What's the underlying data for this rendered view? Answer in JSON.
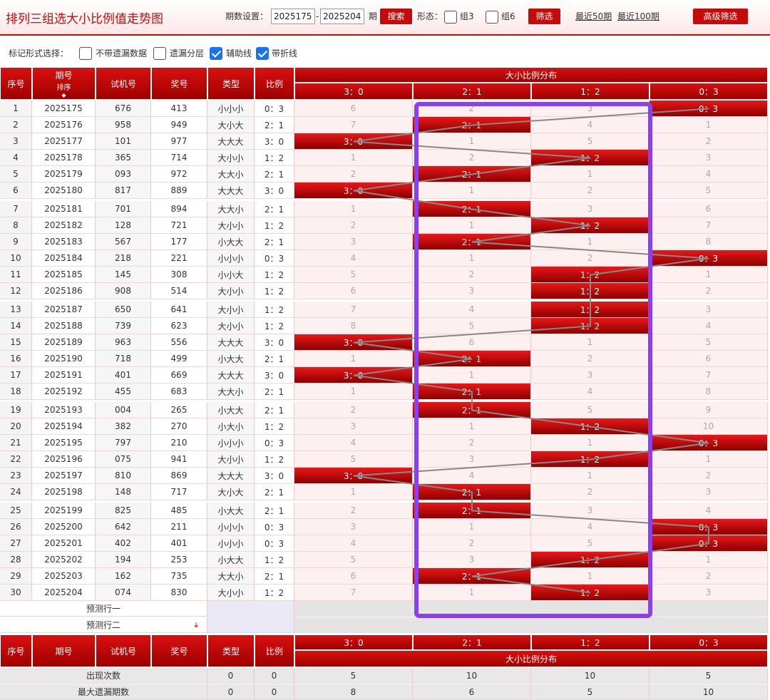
{
  "header": {
    "title": "排列三组选大小比例值走势图",
    "period_label": "期数设置：",
    "from": "2025175",
    "dash": "-",
    "to": "2025204",
    "period_unit": "期",
    "search": "搜索",
    "form_label": "形态：",
    "g3": "组3",
    "g6": "组6",
    "filter": "筛选",
    "recent50": "最近50期",
    "recent100": "最近100期",
    "advanced": "高级筛选"
  },
  "options": {
    "label": "标记形式选择：",
    "items": [
      {
        "label": "不带遗漏数据",
        "checked": false
      },
      {
        "label": "遗漏分层",
        "checked": false
      },
      {
        "label": "辅助线",
        "checked": true
      },
      {
        "label": "带折线",
        "checked": true
      }
    ]
  },
  "table": {
    "h_no": "序号",
    "h_period": "期号",
    "h_sort": "排序",
    "h_trial": "试机号",
    "h_award": "奖号",
    "h_type": "类型",
    "h_ratio": "比例",
    "h_dist": "大小比例分布",
    "cats": [
      "3：0",
      "2：1",
      "1：2",
      "0：3"
    ],
    "rows": [
      [
        "1",
        "2025175",
        "676",
        "413",
        "小小小",
        "0：3",
        [
          "6",
          "2",
          "3",
          "0：3"
        ]
      ],
      [
        "2",
        "2025176",
        "958",
        "949",
        "大小大",
        "2：1",
        [
          "7",
          "2：1",
          "4",
          "1"
        ]
      ],
      [
        "3",
        "2025177",
        "101",
        "977",
        "大大大",
        "3：0",
        [
          "3：0",
          "1",
          "5",
          "2"
        ]
      ],
      [
        "4",
        "2025178",
        "365",
        "714",
        "大小小",
        "1：2",
        [
          "1",
          "2",
          "1：2",
          "3"
        ]
      ],
      [
        "5",
        "2025179",
        "093",
        "972",
        "大大小",
        "2：1",
        [
          "2",
          "2：1",
          "1",
          "4"
        ]
      ],
      [
        "6",
        "2025180",
        "817",
        "889",
        "大大大",
        "3：0",
        [
          "3：0",
          "1",
          "2",
          "5"
        ]
      ],
      [
        "7",
        "2025181",
        "701",
        "894",
        "大大小",
        "2：1",
        [
          "1",
          "2：1",
          "3",
          "6"
        ]
      ],
      [
        "8",
        "2025182",
        "128",
        "721",
        "大小小",
        "1：2",
        [
          "2",
          "1",
          "1：2",
          "7"
        ]
      ],
      [
        "9",
        "2025183",
        "567",
        "177",
        "小大大",
        "2：1",
        [
          "3",
          "2：1",
          "1",
          "8"
        ]
      ],
      [
        "10",
        "2025184",
        "218",
        "221",
        "小小小",
        "0：3",
        [
          "4",
          "1",
          "2",
          "0：3"
        ]
      ],
      [
        "11",
        "2025185",
        "145",
        "308",
        "小小大",
        "1：2",
        [
          "5",
          "2",
          "1：2",
          "1"
        ]
      ],
      [
        "12",
        "2025186",
        "908",
        "514",
        "大小小",
        "1：2",
        [
          "6",
          "3",
          "1：2",
          "2"
        ]
      ],
      [
        "13",
        "2025187",
        "650",
        "641",
        "大小小",
        "1：2",
        [
          "7",
          "4",
          "1：2",
          "3"
        ]
      ],
      [
        "14",
        "2025188",
        "739",
        "623",
        "大小小",
        "1：2",
        [
          "8",
          "5",
          "1：2",
          "4"
        ]
      ],
      [
        "15",
        "2025189",
        "963",
        "556",
        "大大大",
        "3：0",
        [
          "3：0",
          "6",
          "1",
          "5"
        ]
      ],
      [
        "16",
        "2025190",
        "718",
        "499",
        "小大大",
        "2：1",
        [
          "1",
          "2：1",
          "2",
          "6"
        ]
      ],
      [
        "17",
        "2025191",
        "401",
        "669",
        "大大大",
        "3：0",
        [
          "3：0",
          "1",
          "3",
          "7"
        ]
      ],
      [
        "18",
        "2025192",
        "455",
        "683",
        "大大小",
        "2：1",
        [
          "1",
          "2：1",
          "4",
          "8"
        ]
      ],
      [
        "19",
        "2025193",
        "004",
        "265",
        "小大大",
        "2：1",
        [
          "2",
          "2：1",
          "5",
          "9"
        ]
      ],
      [
        "20",
        "2025194",
        "382",
        "270",
        "小大小",
        "1：2",
        [
          "3",
          "1",
          "1：2",
          "10"
        ]
      ],
      [
        "21",
        "2025195",
        "797",
        "210",
        "小小小",
        "0：3",
        [
          "4",
          "2",
          "1",
          "0：3"
        ]
      ],
      [
        "22",
        "2025196",
        "075",
        "941",
        "大小小",
        "1：2",
        [
          "5",
          "3",
          "1：2",
          "1"
        ]
      ],
      [
        "23",
        "2025197",
        "810",
        "869",
        "大大大",
        "3：0",
        [
          "3：0",
          "4",
          "1",
          "2"
        ]
      ],
      [
        "24",
        "2025198",
        "148",
        "717",
        "大小大",
        "2：1",
        [
          "1",
          "2：1",
          "2",
          "3"
        ]
      ],
      [
        "25",
        "2025199",
        "825",
        "485",
        "小大大",
        "2：1",
        [
          "2",
          "2：1",
          "3",
          "4"
        ]
      ],
      [
        "26",
        "2025200",
        "642",
        "211",
        "小小小",
        "0：3",
        [
          "3",
          "1",
          "4",
          "0：3"
        ]
      ],
      [
        "27",
        "2025201",
        "402",
        "401",
        "小小小",
        "0：3",
        [
          "4",
          "2",
          "5",
          "0：3"
        ]
      ],
      [
        "28",
        "2025202",
        "194",
        "253",
        "小大大",
        "1：2",
        [
          "5",
          "3",
          "1：2",
          "1"
        ]
      ],
      [
        "29",
        "2025203",
        "162",
        "735",
        "大大小",
        "2：1",
        [
          "6",
          "2：1",
          "1",
          "2"
        ]
      ],
      [
        "30",
        "2025204",
        "074",
        "830",
        "大小小",
        "1：2",
        [
          "7",
          "1",
          "1：2",
          "3"
        ]
      ]
    ],
    "forecast": [
      "预测行一",
      "预测行二"
    ],
    "footer_stats": [
      {
        "label": "出现次数",
        "values": [
          "0",
          "0",
          "5",
          "10",
          "10",
          "5"
        ]
      },
      {
        "label": "最大遗漏期数",
        "values": [
          "0",
          "0",
          "8",
          "6",
          "5",
          "10"
        ]
      }
    ]
  },
  "colors": {
    "accent": "#c60a0a",
    "highlight_box": "#8a3ff0"
  }
}
